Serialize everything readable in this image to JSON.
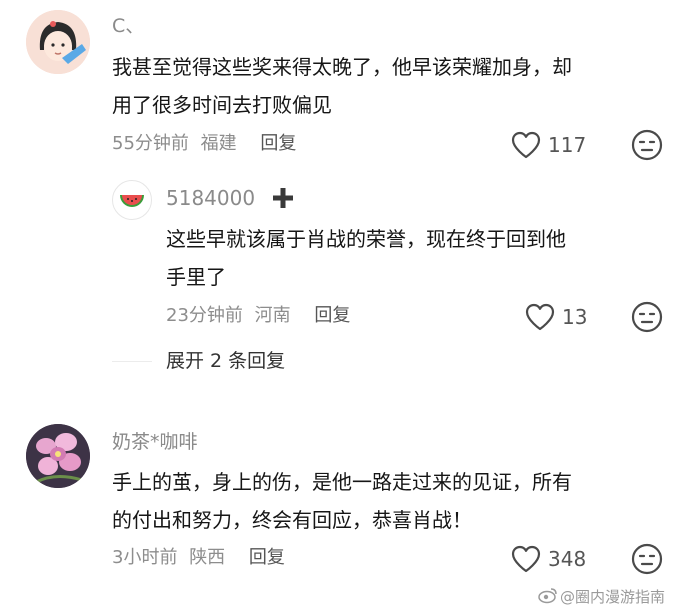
{
  "comments": [
    {
      "username": "C、",
      "text_line1": "我甚至觉得这些奖来得太晚了，他早该荣耀加身，却",
      "text_line2": "用了很多时间去打败偏见",
      "time": "55分钟前",
      "location": "福建",
      "reply_label": "回复",
      "likes": "117",
      "reply": {
        "username": "5184000",
        "text_line1": "这些早就该属于肖战的荣誉，现在终于回到他",
        "text_line2": "手里了",
        "time": "23分钟前",
        "location": "河南",
        "reply_label": "回复",
        "likes": "13"
      },
      "expand_label": "展开 2 条回复"
    },
    {
      "username": "奶茶*咖啡",
      "text_line1": "手上的茧，身上的伤，是他一路走过来的见证，所有",
      "text_line2": "的付出和努力，终会有回应，恭喜肖战！",
      "time": "3小时前",
      "location": "陕西",
      "reply_label": "回复",
      "likes": "348"
    }
  ],
  "watermark": "@圈内漫游指南",
  "colors": {
    "secondary_text": "#8d8d8d",
    "body_text": "#161616",
    "icon_stroke": "#4a4a4a"
  }
}
